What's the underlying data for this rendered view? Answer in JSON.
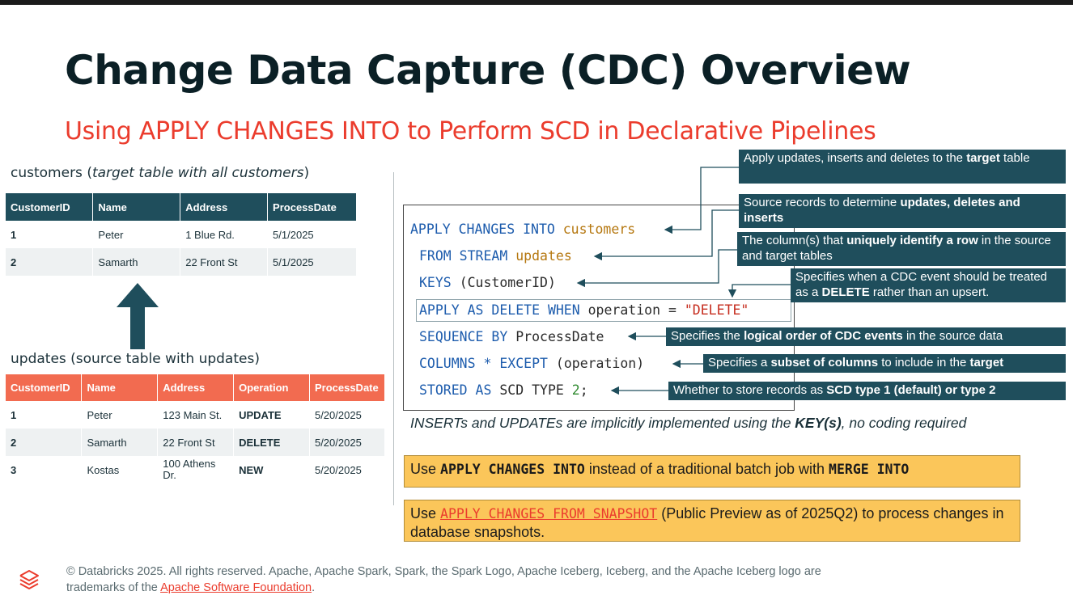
{
  "slide": {
    "title": "Change Data Capture (CDC) Overview",
    "subtitle": "Using APPLY CHANGES INTO to Perform SCD in Declarative Pipelines"
  },
  "customers_table": {
    "label_prefix": "customers (",
    "label_italic": "target table with all customers",
    "label_suffix": ")",
    "headers": [
      "CustomerID",
      "Name",
      "Address",
      "ProcessDate"
    ],
    "rows": [
      [
        "1",
        "Peter",
        "1 Blue Rd.",
        "5/1/2025"
      ],
      [
        "2",
        "Samarth",
        "22 Front St",
        "5/1/2025"
      ]
    ]
  },
  "updates_table": {
    "label": "updates (source table with updates)",
    "headers": [
      "CustomerID",
      "Name",
      "Address",
      "Operation",
      "ProcessDate"
    ],
    "rows": [
      [
        "1",
        "Peter",
        "123 Main St.",
        "UPDATE",
        "5/20/2025"
      ],
      [
        "2",
        "Samarth",
        "22 Front St",
        "DELETE",
        "5/20/2025"
      ],
      [
        "3",
        "Kostas",
        "100 Athens Dr.",
        "NEW",
        "5/20/2025"
      ]
    ]
  },
  "code": {
    "l1_kw": "APPLY CHANGES INTO",
    "l1_id": "customers",
    "l2_kw": "FROM STREAM",
    "l2_id": "updates",
    "l3_kw": "KEYS",
    "l3_rest": "(CustomerID)",
    "l4_kw": "APPLY AS DELETE WHEN",
    "l4_mid": "operation =",
    "l4_str": "\"DELETE\"",
    "l5_kw": "SEQUENCE BY",
    "l5_rest": "ProcessDate",
    "l6_kw": "COLUMNS * EXCEPT",
    "l6_rest": "(operation)",
    "l7_kw": "STORED AS",
    "l7_mid": "SCD TYPE",
    "l7_num": "2",
    "l7_end": ";"
  },
  "annotations": {
    "a1_pre": "Apply updates, inserts and deletes to the ",
    "a1_bold": "target",
    "a1_post": " table",
    "a2_pre": "Source records to determine ",
    "a2_bold": "updates, deletes and inserts",
    "a3_pre": "The column(s) that ",
    "a3_bold": "uniquely identify a row",
    "a3_post": " in the source and target tables",
    "a4_pre": "Specifies when a CDC event should be treated as a ",
    "a4_bold": "DELETE",
    "a4_post": " rather than an upsert.",
    "a5_pre": "Specifies the ",
    "a5_bold": "logical order of CDC events",
    "a5_post": " in the source data",
    "a6_pre": "Specifies a ",
    "a6_bold": "subset of columns",
    "a6_mid": " to include in the ",
    "a6_bold2": "target",
    "a7_pre": "Whether to store records as ",
    "a7_bold": "SCD type 1 (default) or type 2"
  },
  "note": {
    "pre": "INSERTs and UPDATEs are implicitly implemented using the ",
    "bold": "KEY(s)",
    "post": ", no coding required"
  },
  "callouts": {
    "c1_pre": "Use ",
    "c1_code": "APPLY CHANGES INTO",
    "c1_mid": " instead of a traditional batch job with ",
    "c1_code2": "MERGE INTO",
    "c2_pre": "Use ",
    "c2_link": "APPLY CHANGES FROM SNAPSHOT",
    "c2_post": " (Public Preview as of 2025Q2) to process changes in database snapshots."
  },
  "footer": {
    "text": "© Databricks 2025. All rights reserved. Apache, Apache Spark, Spark, the Spark Logo, Apache Iceberg, Iceberg, and the Apache Iceberg logo are trademarks of the ",
    "link": "Apache Software Foundation",
    "end": "."
  },
  "colors": {
    "accent_red": "#eb3c2d",
    "navy": "#1f4e5c",
    "coral": "#f26b50",
    "callout_yellow": "#fbc65a"
  }
}
